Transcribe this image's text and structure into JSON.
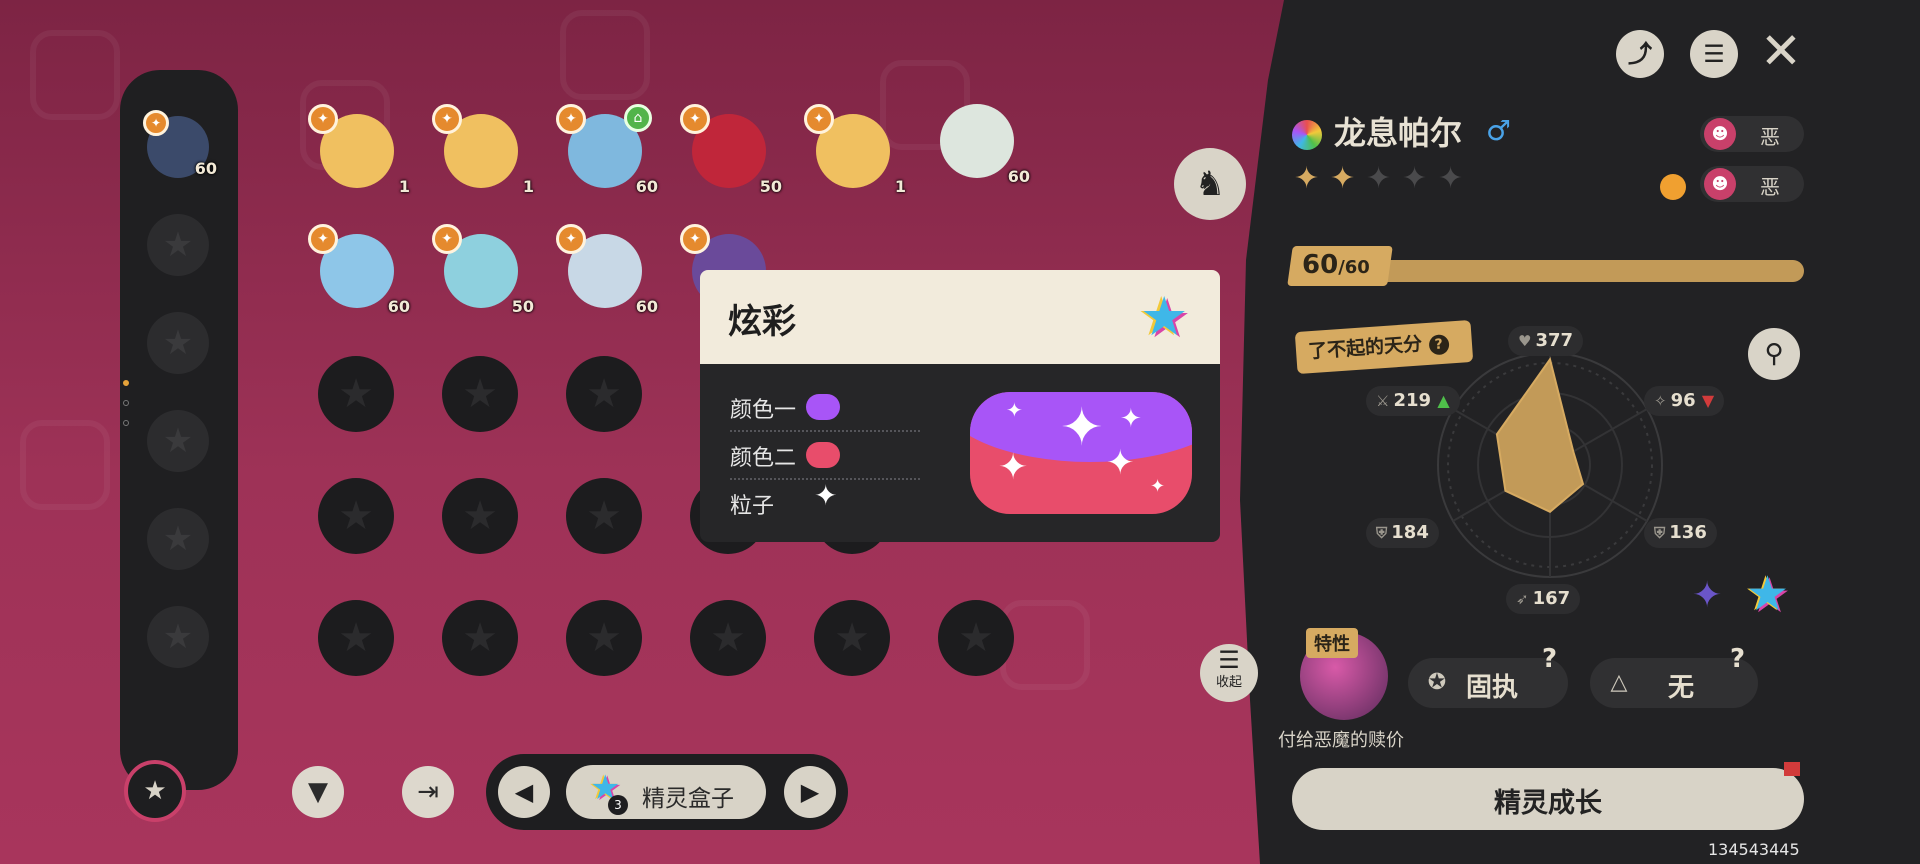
{
  "creature": {
    "name": "龙息帕尔",
    "gender_symbol": "♂",
    "types": [
      "恶",
      "恶"
    ],
    "stars_filled": 2,
    "stars_total": 5,
    "level_current": "60",
    "level_max": "/60",
    "level_progress": 1.0,
    "talent_label": "了不起的天分",
    "stats": {
      "hp": "377",
      "attack": "219",
      "special_attack": "96",
      "defense": "184",
      "special_defense": "136",
      "speed": "167"
    },
    "trait_badge": "特性",
    "trait_desc": "付给恶魔的赎价",
    "ability": "固执",
    "ability_secondary": "无",
    "collapse_label": "收起",
    "grow_button": "精灵成长"
  },
  "party_levels": [
    "60"
  ],
  "box_creatures": [
    {
      "level": "1",
      "color": "#f0c060"
    },
    {
      "level": "1",
      "color": "#f0c060"
    },
    {
      "level": "60",
      "color": "#7fb8de"
    },
    {
      "level": "50",
      "color": "#c0263a"
    },
    {
      "level": "1",
      "color": "#f0c060"
    },
    {
      "level": "60",
      "color": "#dde6de"
    },
    {
      "level": "60",
      "color": "#8ec6e8"
    },
    {
      "level": "50",
      "color": "#8ed0de"
    },
    {
      "level": "60",
      "color": "#c8d8e6"
    },
    {
      "level": "",
      "color": "#6a4a9a"
    }
  ],
  "shiny_popup": {
    "title": "炫彩",
    "color1_label": "颜色一",
    "color1": "#a855f7",
    "color2_label": "颜色二",
    "color2": "#e84d6b",
    "particle_label": "粒子",
    "particle_icon": "sparkle-icon"
  },
  "pager": {
    "label": "精灵盒子",
    "count": "3"
  },
  "uid": "134543445",
  "colors": {
    "background": "#8a2a4d",
    "panel": "#222224",
    "gold": "#d6aa61"
  }
}
